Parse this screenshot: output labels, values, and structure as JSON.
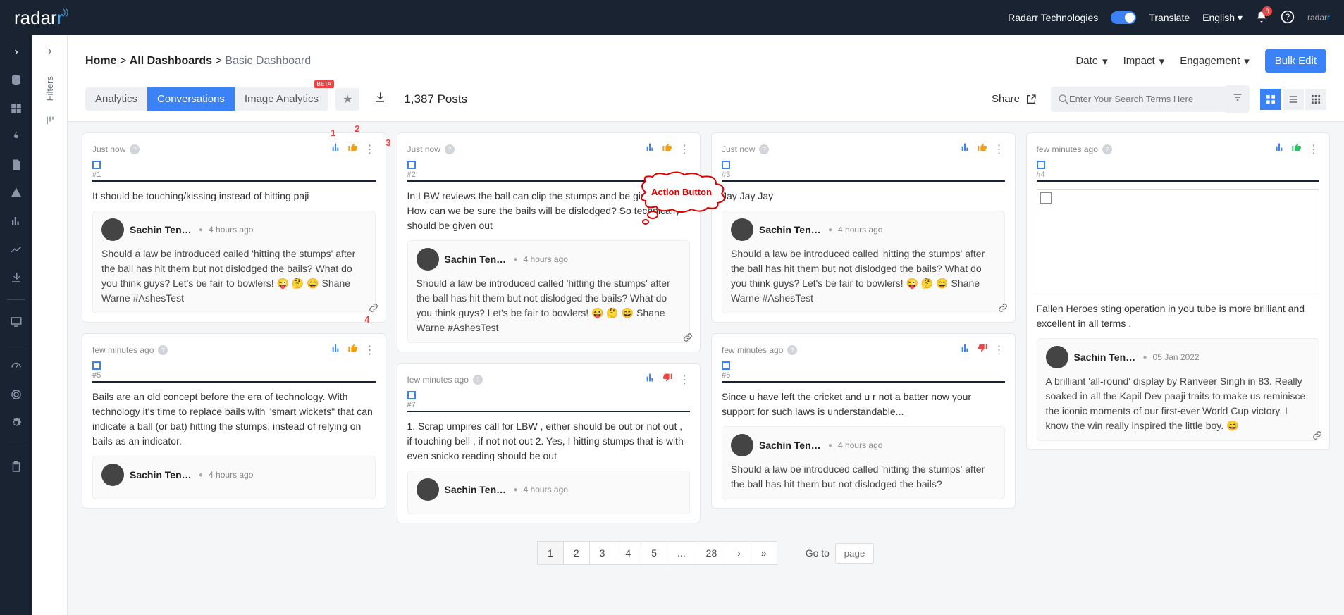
{
  "hdr": {
    "company": "Radarr Technologies",
    "translate": "Translate",
    "lang": "English",
    "notif": "8"
  },
  "bc": {
    "home": "Home",
    "all": "All Dashboards",
    "cur": "Basic Dashboard",
    "sep": " > "
  },
  "tfilt": {
    "date": "Date",
    "impact": "Impact",
    "eng": "Engagement"
  },
  "bedit": "Bulk Edit",
  "tabs": {
    "a": "Analytics",
    "c": "Conversations",
    "i": "Image Analytics",
    "beta": "BETA"
  },
  "count": "1,387 Posts",
  "cloud": "Action Button",
  "share": "Share",
  "srch": "Enter Your Search Terms Here",
  "flabel": "Filters",
  "annot": {
    "a1": "1",
    "a2": "2",
    "a3": "3",
    "a4": "4"
  },
  "qauthor": "Sachin Tend…",
  "qauthor2": "Sachin Tendu…",
  "qtime": "4 hours ago",
  "qtxt": "Should a law be introduced called 'hitting the stumps' after the ball has hit them but not dislodged the bails? What do you think guys? Let's be fair to bowlers! 😜 🤔 😄 Shane Warne #AshesTest",
  "qtxt_s": "Should a law be introduced called 'hitting the stumps' after the ball has hit them but not dislodged the bails?",
  "cards": {
    "c1": {
      "time": "Just now",
      "num": "#1",
      "txt": "It should be touching/kissing instead of hitting paji"
    },
    "c2": {
      "time": "Just now",
      "num": "#2",
      "txt": "In LBW reviews the ball can clip the stumps and be given out. How can we be sure the bails will be dislodged? So technically should be given out"
    },
    "c3": {
      "time": "Just now",
      "num": "#3",
      "txt": "Jay Jay Jay"
    },
    "c4": {
      "time": "few minutes ago",
      "num": "#4",
      "txt": "Fallen Heroes sting operation in you tube is more brilliant and excellent in all terms .",
      "qtime": "05 Jan 2022",
      "qtxt": "A brilliant 'all-round' display by Ranveer Singh in 83. Really soaked in all the Kapil Dev paaji traits to make us reminisce the iconic moments of our first-ever World Cup victory. I know the win really inspired the little boy. 😄"
    },
    "c5": {
      "time": "few minutes ago",
      "num": "#5",
      "txt": "Bails are an old concept before the era of technology. With technology it's time to replace bails with \"smart wickets\" that can indicate a ball (or bat) hitting the stumps, instead of relying on bails as an indicator."
    },
    "c6": {
      "time": "few minutes ago",
      "num": "#6",
      "txt": "Since u have left the cricket and u r not a batter now your support for such laws is understandable..."
    },
    "c7": {
      "time": "few minutes ago",
      "num": "#7",
      "txt": "1. Scrap umpires call for LBW , either should be out or not out , if touching bell , if not not out 2. Yes, I hitting stumps that is with even snicko reading should be out"
    }
  },
  "pag": {
    "p1": "1",
    "p2": "2",
    "p3": "3",
    "p4": "4",
    "p5": "5",
    "el": "...",
    "last": "28",
    "goto": "Go to",
    "ph": "page"
  }
}
